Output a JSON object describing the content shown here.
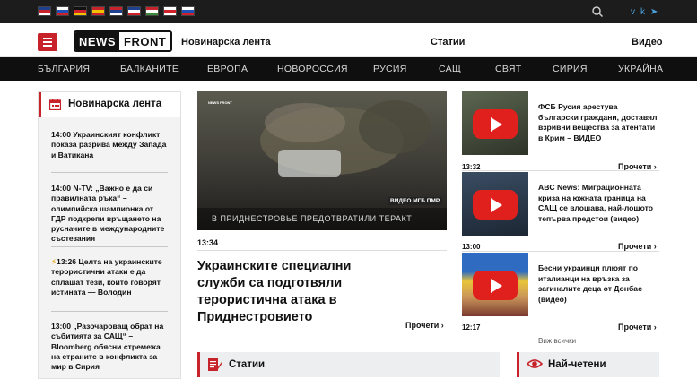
{
  "topbar": {
    "flags": [
      {
        "name": "english-flag-icon",
        "colors": [
          "#1f3f8f",
          "#c8222a",
          "#ffffff"
        ]
      },
      {
        "name": "russian-flag-icon",
        "colors": [
          "#ffffff",
          "#1f4fb5",
          "#d0212a"
        ]
      },
      {
        "name": "german-flag-icon",
        "colors": [
          "#111111",
          "#d0212a",
          "#f2c200"
        ]
      },
      {
        "name": "spanish-flag-icon",
        "colors": [
          "#c8222a",
          "#f2c200",
          "#c8222a"
        ]
      },
      {
        "name": "serbian-flag-icon",
        "colors": [
          "#c8222a",
          "#1f3f8f",
          "#ffffff"
        ]
      },
      {
        "name": "french-flag-icon",
        "colors": [
          "#1f3f8f",
          "#ffffff",
          "#d0212a"
        ]
      },
      {
        "name": "hungarian-flag-icon",
        "colors": [
          "#c8222a",
          "#ffffff",
          "#3c8a3c"
        ]
      },
      {
        "name": "georgian-flag-icon",
        "colors": [
          "#ffffff",
          "#d0212a",
          "#ffffff"
        ]
      },
      {
        "name": "slovenian-flag-icon",
        "colors": [
          "#ffffff",
          "#1f4fb5",
          "#d0212a"
        ]
      }
    ],
    "social_icons": [
      "vk-icon",
      "telegram-icon"
    ]
  },
  "header": {
    "logo_part1": "NEWS",
    "logo_part2": "FRONT",
    "nav": [
      "Новинарска лента",
      "Статии",
      "Видео"
    ]
  },
  "categories": [
    "БЪЛГАРИЯ",
    "БАЛКАНИТЕ",
    "ЕВРОПА",
    "НОВОРОССИЯ",
    "РУСИЯ",
    "САЩ",
    "СВЯТ",
    "СИРИЯ",
    "УКРАЙНА"
  ],
  "news_feed": {
    "title": "Новинарска лента",
    "items": [
      {
        "time": "14:00",
        "text": "Украинският конфликт показа разрива между Запада и Ватикана"
      },
      {
        "time": "14:00",
        "text": "N-TV: „Важно е да си правилната ръка“ – олимпийска шампионка от ГДР подкрепи връщането на русначите в международните състезания"
      },
      {
        "time": "13:26",
        "text": "Целта на украинските терористични атаки е да сплашат тези, които говорят истината — Володин",
        "flash": true
      },
      {
        "time": "13:00",
        "text": "„Разочароващ обрат на събитията за САЩ“ – Bloomberg обясни стремежа на страните в конфликта за мир в Сирия"
      }
    ]
  },
  "featured": {
    "image_caption": "В ПРИДНЕСТРОВЬЕ ПРЕДОТВРАТИЛИ ТЕРАКТ",
    "image_source": "ВИДЕО МГБ ПМР",
    "image_logo": "NEWS FRONT",
    "time": "13:34",
    "title": "Украинските специални служби са подготвяли терористична атака в Приднестровието",
    "read_more": "Прочети"
  },
  "videos": [
    {
      "time": "13:32",
      "title": "ФСБ Русия арестува български граждани, доставял взривни вещества за атентати в Крим – ВИДЕО",
      "read_more": "Прочети"
    },
    {
      "time": "13:00",
      "title": "ABC News: Миграционната криза на южната граница на САЩ се влошава, най-лошото тепърва предстои (видео)",
      "read_more": "Прочети"
    },
    {
      "time": "12:17",
      "title": "Бесни украинци плюят по италианци на връзка за загиналите деца от Донбас (видео)",
      "read_more": "Прочети"
    }
  ],
  "see_all": "Виж всички",
  "sections": [
    {
      "title": "Статии",
      "icon": "articles-icon"
    },
    {
      "title": "Най-четени",
      "icon": "eye-icon"
    }
  ],
  "colors": {
    "accent": "#c8222a",
    "play": "#e0201d"
  }
}
